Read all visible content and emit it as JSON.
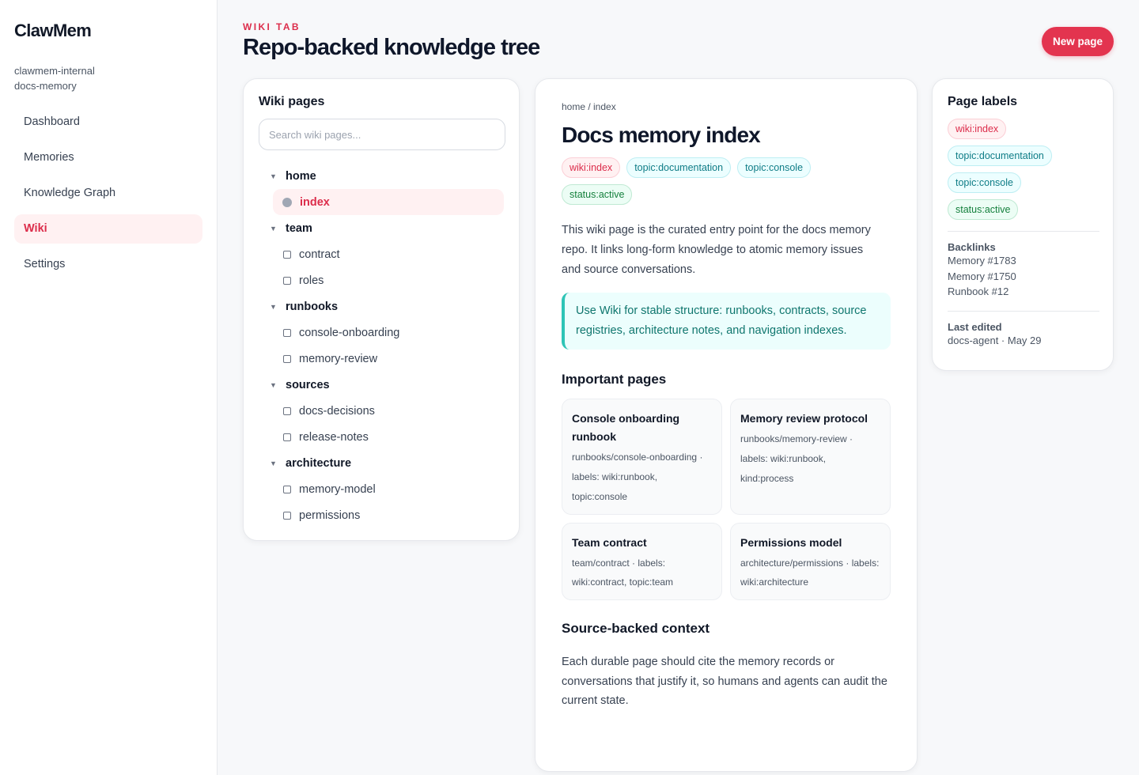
{
  "app": {
    "brand": "ClawMem",
    "workspace_line1": "clawmem-internal",
    "workspace_line2": "docs-memory",
    "accent_color": "#dc2d4b"
  },
  "sidebar": {
    "items": [
      {
        "label": "Dashboard",
        "active": false
      },
      {
        "label": "Memories",
        "active": false
      },
      {
        "label": "Knowledge Graph",
        "active": false
      },
      {
        "label": "Wiki",
        "active": true
      },
      {
        "label": "Settings",
        "active": false
      }
    ]
  },
  "header": {
    "eyebrow": "WIKI TAB",
    "title": "Repo-backed knowledge tree",
    "new_page_label": "New page"
  },
  "tree": {
    "title": "Wiki pages",
    "search_placeholder": "Search wiki pages...",
    "groups": [
      {
        "name": "home",
        "pages": [
          "index"
        ]
      },
      {
        "name": "team",
        "pages": [
          "contract",
          "roles"
        ]
      },
      {
        "name": "runbooks",
        "pages": [
          "console-onboarding",
          "memory-review"
        ]
      },
      {
        "name": "sources",
        "pages": [
          "docs-decisions",
          "release-notes"
        ]
      },
      {
        "name": "architecture",
        "pages": [
          "memory-model",
          "permissions"
        ]
      }
    ],
    "active_page": "index",
    "caret_icon": "caret-down-icon"
  },
  "doc": {
    "breadcrumb": "home / index",
    "title": "Docs memory index",
    "labels": [
      {
        "text": "wiki:index",
        "tone": "red"
      },
      {
        "text": "topic:documentation",
        "tone": "cyan"
      },
      {
        "text": "topic:console",
        "tone": "cyan"
      },
      {
        "text": "status:active",
        "tone": "green"
      }
    ],
    "lead": "This wiki page is the curated entry point for the docs memory repo. It links long-form knowledge to atomic memory issues and source conversations.",
    "callout": "Use Wiki for stable structure: runbooks, contracts, source registries, architecture notes, and navigation indexes.",
    "important_title": "Important pages",
    "important_pages": [
      {
        "title": "Console onboarding runbook",
        "meta": "runbooks/console-onboarding · labels: wiki:runbook, topic:console"
      },
      {
        "title": "Memory review protocol",
        "meta": "runbooks/memory-review · labels: wiki:runbook, kind:process"
      },
      {
        "title": "Team contract",
        "meta": "team/contract · labels: wiki:contract, topic:team"
      },
      {
        "title": "Permissions model",
        "meta": "architecture/permissions · labels: wiki:architecture"
      }
    ],
    "context_title": "Source-backed context",
    "context_text": "Each durable page should cite the memory records or conversations that justify it, so humans and agents can audit the current state."
  },
  "meta": {
    "title": "Page labels",
    "labels": [
      {
        "text": "wiki:index",
        "tone": "red"
      },
      {
        "text": "topic:documentation",
        "tone": "cyan"
      },
      {
        "text": "topic:console",
        "tone": "cyan"
      },
      {
        "text": "status:active",
        "tone": "green"
      }
    ],
    "backlinks_title": "Backlinks",
    "backlinks": [
      "Memory #1783",
      "Memory #1750",
      "Runbook #12"
    ],
    "last_edited_title": "Last edited",
    "last_edited": "docs-agent · May 29"
  }
}
